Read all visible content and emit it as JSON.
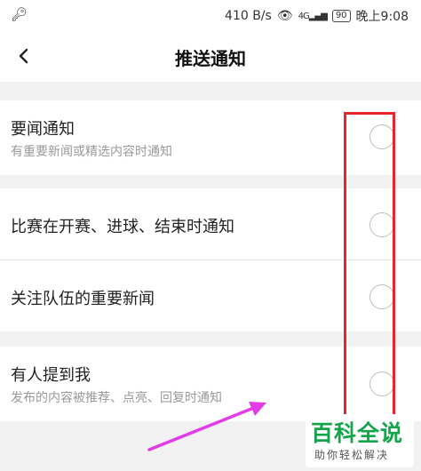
{
  "status_bar": {
    "speed": "410 B/s",
    "network": "4G",
    "battery": "90",
    "time": "晚上9:08"
  },
  "header": {
    "back_icon": "chevron-left-icon",
    "title": "推送通知"
  },
  "settings": [
    {
      "title": "要闻通知",
      "subtitle": "有重要新闻或精选内容时通知"
    },
    {
      "title": "比赛在开赛、进球、结束时通知"
    },
    {
      "title": "关注队伍的重要新闻"
    },
    {
      "title": "有人提到我",
      "subtitle": "发布的内容被推荐、点亮、回复时通知"
    }
  ],
  "annotation": {
    "highlight_color": "#e8262a",
    "arrow_color": "#e23be8"
  },
  "watermark": {
    "brand": "百科全说",
    "slogan": "助你轻松解决"
  }
}
